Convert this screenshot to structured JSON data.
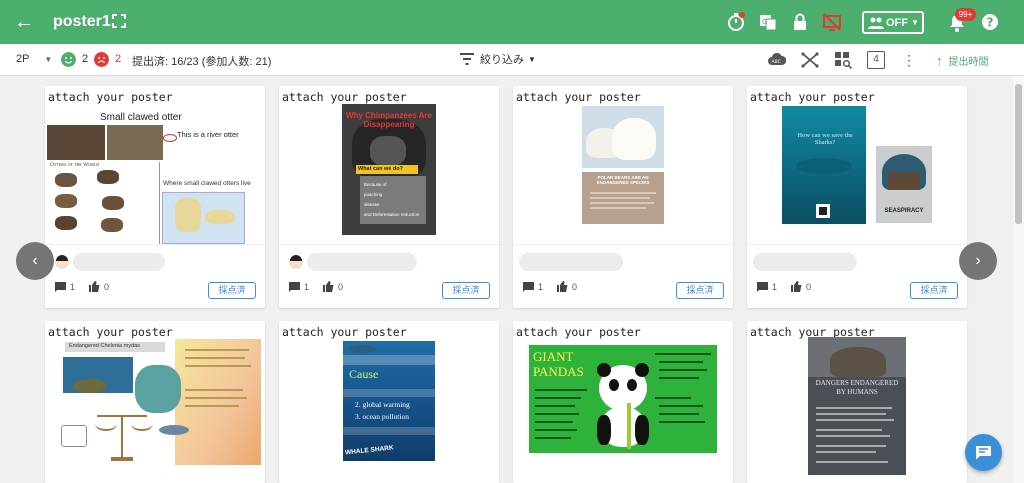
{
  "appbar": {
    "title": "poster1",
    "bg_color": "#4caf6e",
    "toggle_label": "OFF",
    "notification_badge": "99+",
    "icons": [
      "back-arrow-icon",
      "fullscreen-icon",
      "timer-icon",
      "translate-icon",
      "lock-icon",
      "no-screen-icon",
      "group-icon",
      "bell-icon",
      "help-icon"
    ]
  },
  "toolbar": {
    "page_selector": "2P",
    "happy_count": "2",
    "sad_count": "2",
    "submission_status": "提出済: 16/23 (参加人数: 21)",
    "filter_label": "絞り込み",
    "number_box": "4",
    "submit_time_label": "提出時間"
  },
  "cards": [
    {
      "caption": "attach your poster",
      "likes_count": "1",
      "thumbs_count": "0",
      "graded_label": "採点済",
      "poster": {
        "title": "Small clawed otter",
        "note1": "This is a river otter",
        "subtitle": "Otters of the World",
        "note2": "Where small clawed otters live"
      }
    },
    {
      "caption": "attach your poster",
      "likes_count": "1",
      "thumbs_count": "0",
      "graded_label": "採点済",
      "poster": {
        "title": "Why Chimpanzees Are Disappearing",
        "band": "What can we do?",
        "lines": [
          "Because of",
          "poaching",
          "disease",
          "and Deforestation reduction"
        ]
      }
    },
    {
      "caption": "attach your poster",
      "likes_count": "1",
      "thumbs_count": "0",
      "graded_label": "採点済",
      "poster": {
        "title": "POLAR BEARS ARE AN ENDANGERED SPECIES"
      }
    },
    {
      "caption": "attach your poster",
      "likes_count": "1",
      "thumbs_count": "0",
      "graded_label": "採点済",
      "poster": {
        "title": "How can we save the Sharks?",
        "side_label": "SEASPIRACY"
      }
    },
    {
      "caption": "attach your poster",
      "poster": {
        "title": "Endangered Chelonia mydas"
      }
    },
    {
      "caption": "attach your poster",
      "poster": {
        "title": "Cause",
        "items": [
          "2. global warming",
          "3. ocean pollution"
        ],
        "footer": "WHALE SHARK"
      }
    },
    {
      "caption": "attach your poster",
      "poster": {
        "title": "GIANT PANDAS"
      }
    },
    {
      "caption": "attach your poster",
      "poster": {
        "title": "DANGERS ENDANGERED BY HUMANS"
      }
    }
  ],
  "colors": {
    "accent_green": "#4caf6e",
    "graded_blue": "#3b8fd9",
    "happy_face": "#4caf6e",
    "sad_face": "#e53935"
  }
}
